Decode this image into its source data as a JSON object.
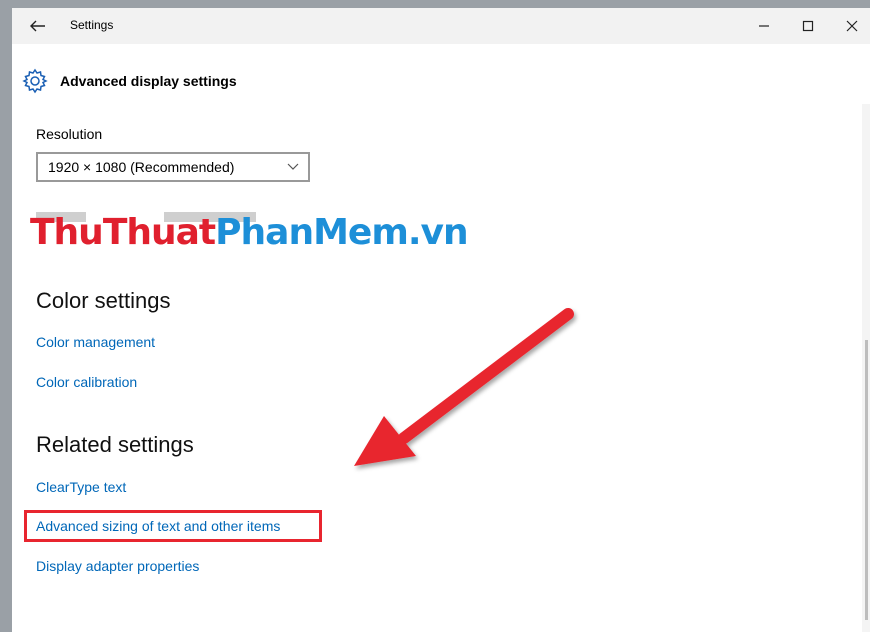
{
  "window": {
    "title": "Settings",
    "controls": {
      "minimize": "—",
      "maximize": "☐",
      "close": "✕"
    }
  },
  "page": {
    "title": "Advanced display settings"
  },
  "resolution": {
    "label": "Resolution",
    "selected": "1920 × 1080 (Recommended)"
  },
  "watermark": {
    "part_red": "ThuThuat",
    "part_blue": "PhanMem.vn"
  },
  "color_settings": {
    "heading": "Color settings",
    "links": [
      "Color management",
      "Color calibration"
    ]
  },
  "related_settings": {
    "heading": "Related settings",
    "links": [
      "ClearType text",
      "Advanced sizing of text and other items",
      "Display adapter properties"
    ]
  },
  "annotation": {
    "arrow_color": "#e8252f",
    "highlight_color": "#e8252f",
    "highlighted_item": "Advanced sizing of text and other items"
  },
  "icons": [
    "back-arrow-icon",
    "minimize-icon",
    "maximize-icon",
    "close-icon",
    "gear-icon",
    "chevron-down-icon"
  ]
}
